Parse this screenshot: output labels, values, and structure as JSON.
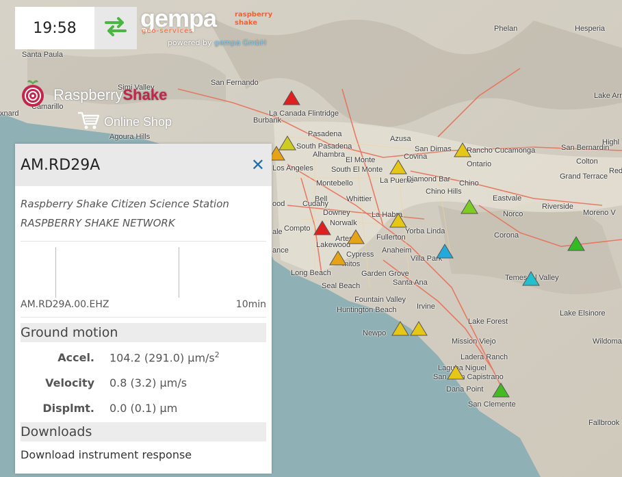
{
  "clock": "19:58",
  "branding": {
    "gempa_word": "gempa",
    "gempa_sub": "geo-services",
    "rs_small_1": "raspberry",
    "rs_small_2": "shake",
    "powered_prefix": "powered by",
    "powered_company": "gempa GmbH",
    "rs_logo_1": "Raspberry",
    "rs_logo_2": "Shake",
    "online_shop": "Online Shop"
  },
  "map_labels": [
    "Phelan",
    "Hesperia",
    "Santa Paula",
    "San Fernando",
    "Simi Valley",
    "Camarillo",
    "xnard",
    "Agoura Hills",
    "Burbank",
    "La Canada Flintridge",
    "Pasadena",
    "South Pasadena",
    "Alhambra",
    "Los Angeles",
    "El Monte",
    "South El Monte",
    "Azusa",
    "Covina",
    "San Dimas",
    "Rancho Cucamonga",
    "San Bernardin",
    "Colton",
    "Ontario",
    "La Puente",
    "Diamond Bar",
    "Chino",
    "Chino Hills",
    "Grand Terrace",
    "Eastvale",
    "Riverside",
    "Moreno V",
    "Norco",
    "Montebello",
    "Bell",
    "Cudahy",
    "Downey",
    "Whittier",
    "La Habra",
    "ood",
    "ale",
    "Compto",
    "Norwalk",
    "Artes",
    "Lakewood",
    "Yorba Linda",
    "Fullerton",
    "Corona",
    "Cypress",
    "Anaheim",
    "Villa Park",
    "ance",
    "mitos",
    "Long Beach",
    "Garden Grove",
    "Santa Ana",
    "Temescal Valley",
    "Seal Beach",
    "Fountain Valley",
    "Huntington Beach",
    "Irvine",
    "Lake Elsinore",
    "Lake Forest",
    "Newpo",
    "Mission Viejo",
    "Wildoma",
    "Ladera Ranch",
    "Laguna Niguel",
    "San Juan Capistrano",
    "Dana Point",
    "San Clemente",
    "Fallbrook",
    "Redlands",
    "Highl",
    "Lake Arr"
  ],
  "stations": [
    {
      "color": "#e02020"
    },
    {
      "color": "#cccc22"
    },
    {
      "color": "#e6a317"
    },
    {
      "color": "#e6c617"
    },
    {
      "color": "#e6c617"
    },
    {
      "color": "#7ccc22"
    },
    {
      "color": "#e6c617"
    },
    {
      "color": "#e02020"
    },
    {
      "color": "#e6a317"
    },
    {
      "color": "#e6a317"
    },
    {
      "color": "#22aadd"
    },
    {
      "color": "#22c0cc"
    },
    {
      "color": "#33bb22"
    },
    {
      "color": "#e6c617"
    },
    {
      "color": "#e6c617"
    },
    {
      "color": "#e6c617"
    },
    {
      "color": "#44bb22"
    }
  ],
  "panel": {
    "title": "AM.RD29A",
    "desc_1": "Raspberry Shake Citizen Science Station",
    "desc_2": "RASPBERRY SHAKE NETWORK",
    "channel": "AM.RD29A.00.EHZ",
    "window": "10min",
    "ground_motion_title": "Ground motion",
    "accel_label": "Accel.",
    "accel_value": "104.2 (291.0) µm/s",
    "accel_sup": "2",
    "velocity_label": "Velocity",
    "velocity_value": "0.8 (3.2) µm/s",
    "displ_label": "Displmt.",
    "displ_value": "0.0 (0.1) µm",
    "downloads_title": "Downloads",
    "download_link": "Download instrument response"
  }
}
